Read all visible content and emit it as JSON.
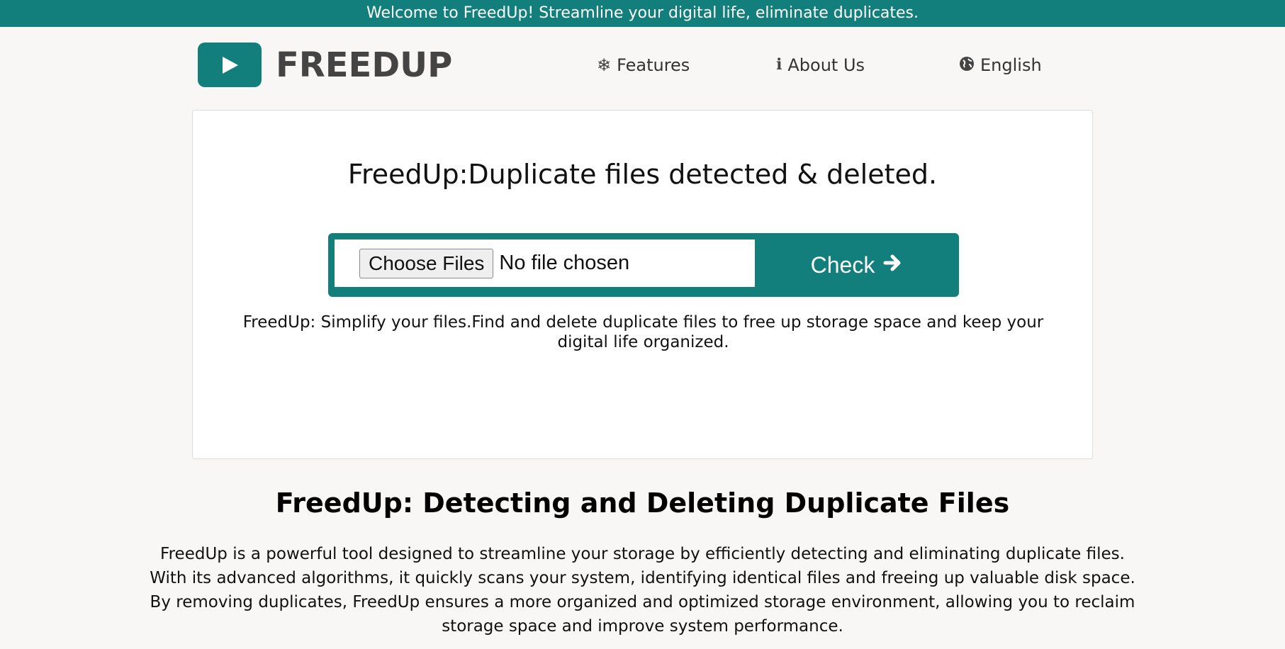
{
  "banner": {
    "text": "Welcome to FreedUp! Streamline your digital life, eliminate duplicates."
  },
  "logo": {
    "text": "FREEDUP",
    "icon": "play-icon"
  },
  "nav": [
    {
      "label": "Features",
      "icon": "snowflake-icon"
    },
    {
      "label": "About Us",
      "icon": "info-icon"
    },
    {
      "label": "English",
      "icon": "globe-icon"
    }
  ],
  "hero": {
    "title": "FreedUp:Duplicate files detected & deleted.",
    "choose_label": "Choose Files",
    "file_status": "No file chosen",
    "check_label": "Check",
    "description": "FreedUp: Simplify your files.Find and delete duplicate files to free up storage space and keep your digital life organized."
  },
  "section": {
    "title": "FreedUp: Detecting and Deleting Duplicate Files",
    "body": "FreedUp is a powerful tool designed to streamline your storage by efficiently detecting and eliminating duplicate files. With its advanced algorithms, it quickly scans your system, identifying identical files and freeing up valuable disk space. By removing duplicates, FreedUp ensures a more organized and optimized storage environment, allowing you to reclaim storage space and improve system performance."
  },
  "colors": {
    "accent": "#137f7c",
    "background": "#f8f7f5"
  }
}
